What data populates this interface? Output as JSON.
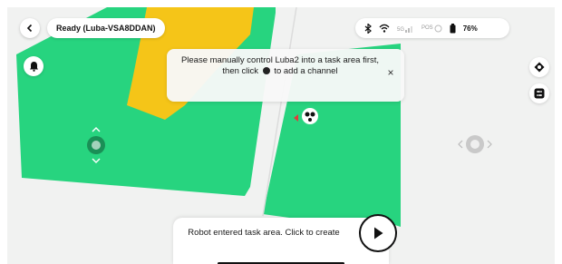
{
  "app": {
    "status_text": "Ready  (Luba-VSA8DDAN)"
  },
  "system": {
    "cell_label": "5G",
    "pos_label": "POS",
    "battery_text": "76%"
  },
  "toast": {
    "text_before_icon": "Please manually control Luba2 into a task area first, then click",
    "text_after_icon": "to add a channel",
    "close_glyph": "×"
  },
  "bottom_panel": {
    "text": "Robot entered task area. Click to create"
  },
  "icons": {
    "back": "chevron-left-icon",
    "bluetooth": "bluetooth-icon",
    "wifi": "wifi-icon",
    "signal": "cellular-signal-icon",
    "pos": "rtk-position-icon",
    "battery": "battery-icon",
    "bell": "bell-icon",
    "locate": "locate-icon",
    "layers": "map-settings-icon",
    "play": "play-icon",
    "robot": "robot-mower-icon",
    "base_station": "charging-station-icon",
    "joystick": "joystick-icon"
  },
  "colors": {
    "mowing_area": "#27d47f",
    "no_go_zone": "#f5c518",
    "background": "#f1f2f1",
    "accent": "#111111"
  }
}
